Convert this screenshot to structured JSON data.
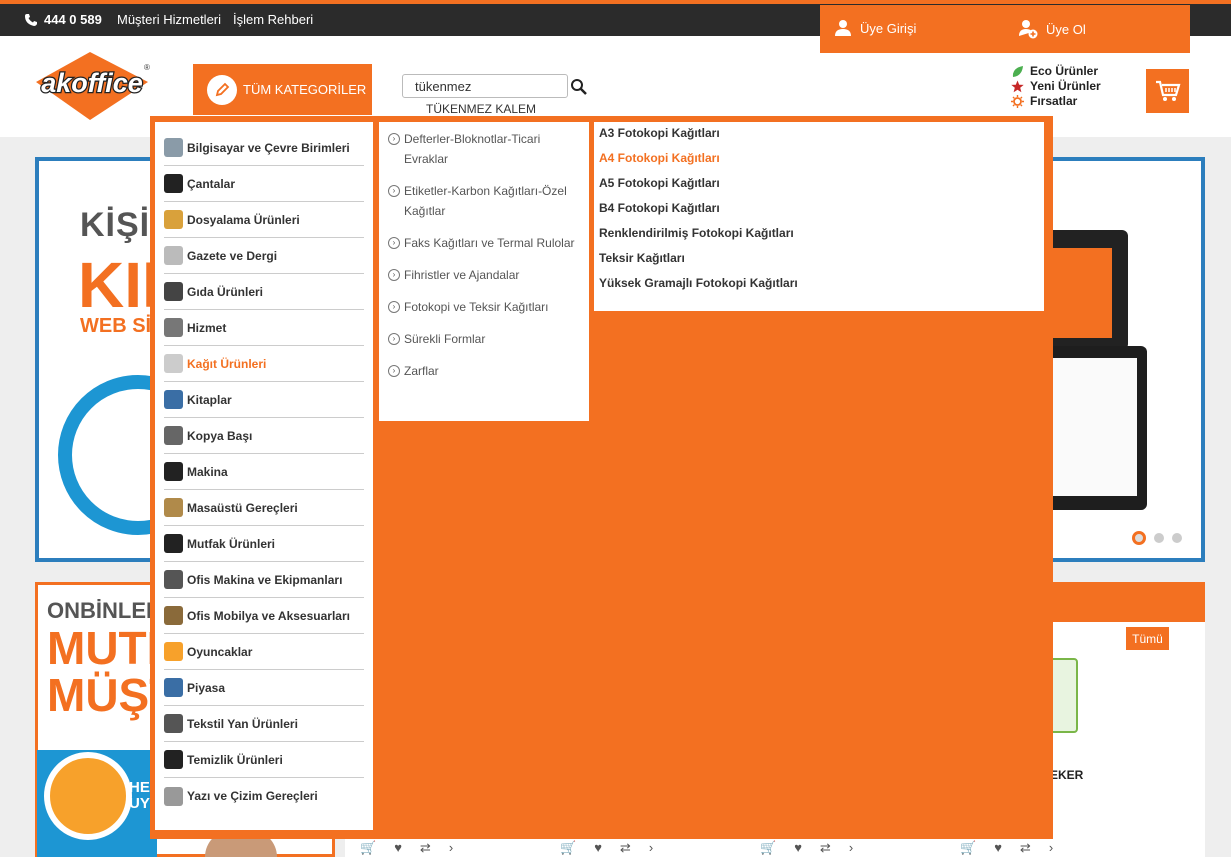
{
  "topbar": {
    "phone": "444 0 589",
    "help": "Müşteri Hizmetleri",
    "guide": "İşlem Rehberi"
  },
  "user": {
    "login": "Üye Girişi",
    "register": "Üye Ol"
  },
  "header": {
    "logo_text": "akoffice",
    "categories_button": "TÜM KATEGORİLER",
    "search_value": "tükenmez",
    "search_suggestion": "TÜKENMEZ KALEM",
    "links": [
      {
        "label": "Eco Ürünler",
        "icon": "leaf-icon"
      },
      {
        "label": "Yeni Ürünler",
        "icon": "star-icon"
      },
      {
        "label": "Fırsatlar",
        "icon": "sun-icon"
      }
    ]
  },
  "categories": [
    {
      "label": "Bilgisayar ve Çevre Birimleri",
      "icon": "computer-icon",
      "color": "#8a9ba8"
    },
    {
      "label": "Çantalar",
      "icon": "bag-icon",
      "color": "#222222"
    },
    {
      "label": "Dosyalama Ürünleri",
      "icon": "binders-icon",
      "color": "#d9a13b"
    },
    {
      "label": "Gazete ve Dergi",
      "icon": "newspaper-icon",
      "color": "#bbbbbb"
    },
    {
      "label": "Gıda Ürünleri",
      "icon": "food-icon",
      "color": "#444444"
    },
    {
      "label": "Hizmet",
      "icon": "tools-icon",
      "color": "#777777"
    },
    {
      "label": "Kağıt Ürünleri",
      "icon": "paper-icon",
      "color": "#cccccc",
      "active": true
    },
    {
      "label": "Kitaplar",
      "icon": "book-icon",
      "color": "#3a6ea5"
    },
    {
      "label": "Kopya Başı",
      "icon": "copier-icon",
      "color": "#666666"
    },
    {
      "label": "Makina",
      "icon": "calculator-icon",
      "color": "#222222"
    },
    {
      "label": "Masaüstü Gereçleri",
      "icon": "desk-icon",
      "color": "#b08a4a"
    },
    {
      "label": "Mutfak Ürünleri",
      "icon": "cutlery-icon",
      "color": "#222222"
    },
    {
      "label": "Ofis Makina ve Ekipmanları",
      "icon": "machine-icon",
      "color": "#555555"
    },
    {
      "label": "Ofis Mobilya ve Aksesuarları",
      "icon": "furniture-icon",
      "color": "#8a6a3a"
    },
    {
      "label": "Oyuncaklar",
      "icon": "toy-icon",
      "color": "#f7a12b"
    },
    {
      "label": "Piyasa",
      "icon": "market-icon",
      "color": "#3a6ea5"
    },
    {
      "label": "Tekstil Yan Ürünleri",
      "icon": "textile-icon",
      "color": "#555555"
    },
    {
      "label": "Temizlik Ürünleri",
      "icon": "broom-icon",
      "color": "#222222"
    },
    {
      "label": "Yazı ve Çizim Gereçleri",
      "icon": "pen-icon",
      "color": "#999999"
    }
  ],
  "subcategories": [
    "Defterler-Bloknotlar-Ticari Evraklar",
    "Etiketler-Karbon Kağıtları-Özel Kağıtlar",
    "Faks Kağıtları ve Termal Rulolar",
    "Fihristler ve Ajandalar",
    "Fotokopi ve Teksir Kağıtları",
    "Sürekli Formlar",
    "Zarflar"
  ],
  "third_level": [
    {
      "label": "A3 Fotokopi Kağıtları"
    },
    {
      "label": "A4 Fotokopi Kağıtları",
      "active": true
    },
    {
      "label": "A5 Fotokopi Kağıtları"
    },
    {
      "label": "B4 Fotokopi Kağıtları"
    },
    {
      "label": "Renklendirilmiş Fotokopi Kağıtları"
    },
    {
      "label": "Teksir Kağıtları"
    },
    {
      "label": "Yüksek Gramajlı Fotokopi Kağıtları"
    }
  ],
  "slider": {
    "line1": "KİŞİSE",
    "line2": "KIR",
    "line3": "WEB SİTE"
  },
  "promo": {
    "line1": "ONBİNLERCE",
    "line2": "MUTLU",
    "line3": "MÜŞTE",
    "badge": "HE UY"
  },
  "products": {
    "all_button": "Tümü",
    "partial_name": "EKER"
  },
  "colors": {
    "accent": "#f37021",
    "topbar": "#2b2b2b",
    "slider_border": "#2c7ebd"
  }
}
